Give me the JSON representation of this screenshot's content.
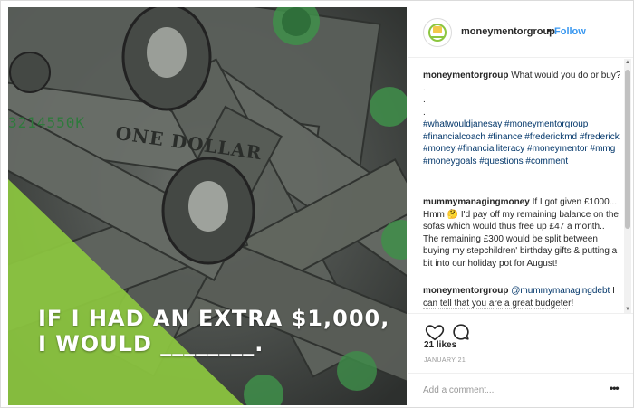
{
  "post": {
    "image_text_line1": "IF I HAD AN EXTRA $1,000,",
    "image_text_line2": "I WOULD ________.",
    "bill_text_serial": "3214550K",
    "bill_text_denomination": "ONE DOLLAR"
  },
  "header": {
    "username": "moneymentorgroup",
    "separator": "•",
    "follow_label": "Follow"
  },
  "caption": {
    "username": "moneymentorgroup",
    "text": "What would you do or buy?",
    "dot1": ".",
    "dot2": ".",
    "dot3": ".",
    "hashtags": "#whatwouldjanesay #moneymentorgroup #financialcoach #finance #frederickmd #frederick #money #financialliteracy #moneymentor #mmg #moneygoals #questions #comment"
  },
  "comments": [
    {
      "username": "mummymanagingmoney",
      "text": "If I got given £1000... Hmm 🤔 I'd pay off my remaining balance on the sofas which would thus free up £47 a month.. The remaining £300 would be split between buying my stepchildren' birthday gifts & putting a bit into our holiday pot for August!"
    },
    {
      "username": "moneymentorgroup",
      "mention": "@mummymanagingdebt",
      "text": "I can tell that you are a great budgeter!"
    }
  ],
  "stats": {
    "likes": "21 likes",
    "date": "JANUARY 21"
  },
  "add_comment": {
    "placeholder": "Add a comment...",
    "more_label": "•••"
  },
  "colors": {
    "accent": "#3897f0",
    "overlay_green": "#8cc63f",
    "bill_dark": "#3e423f"
  }
}
